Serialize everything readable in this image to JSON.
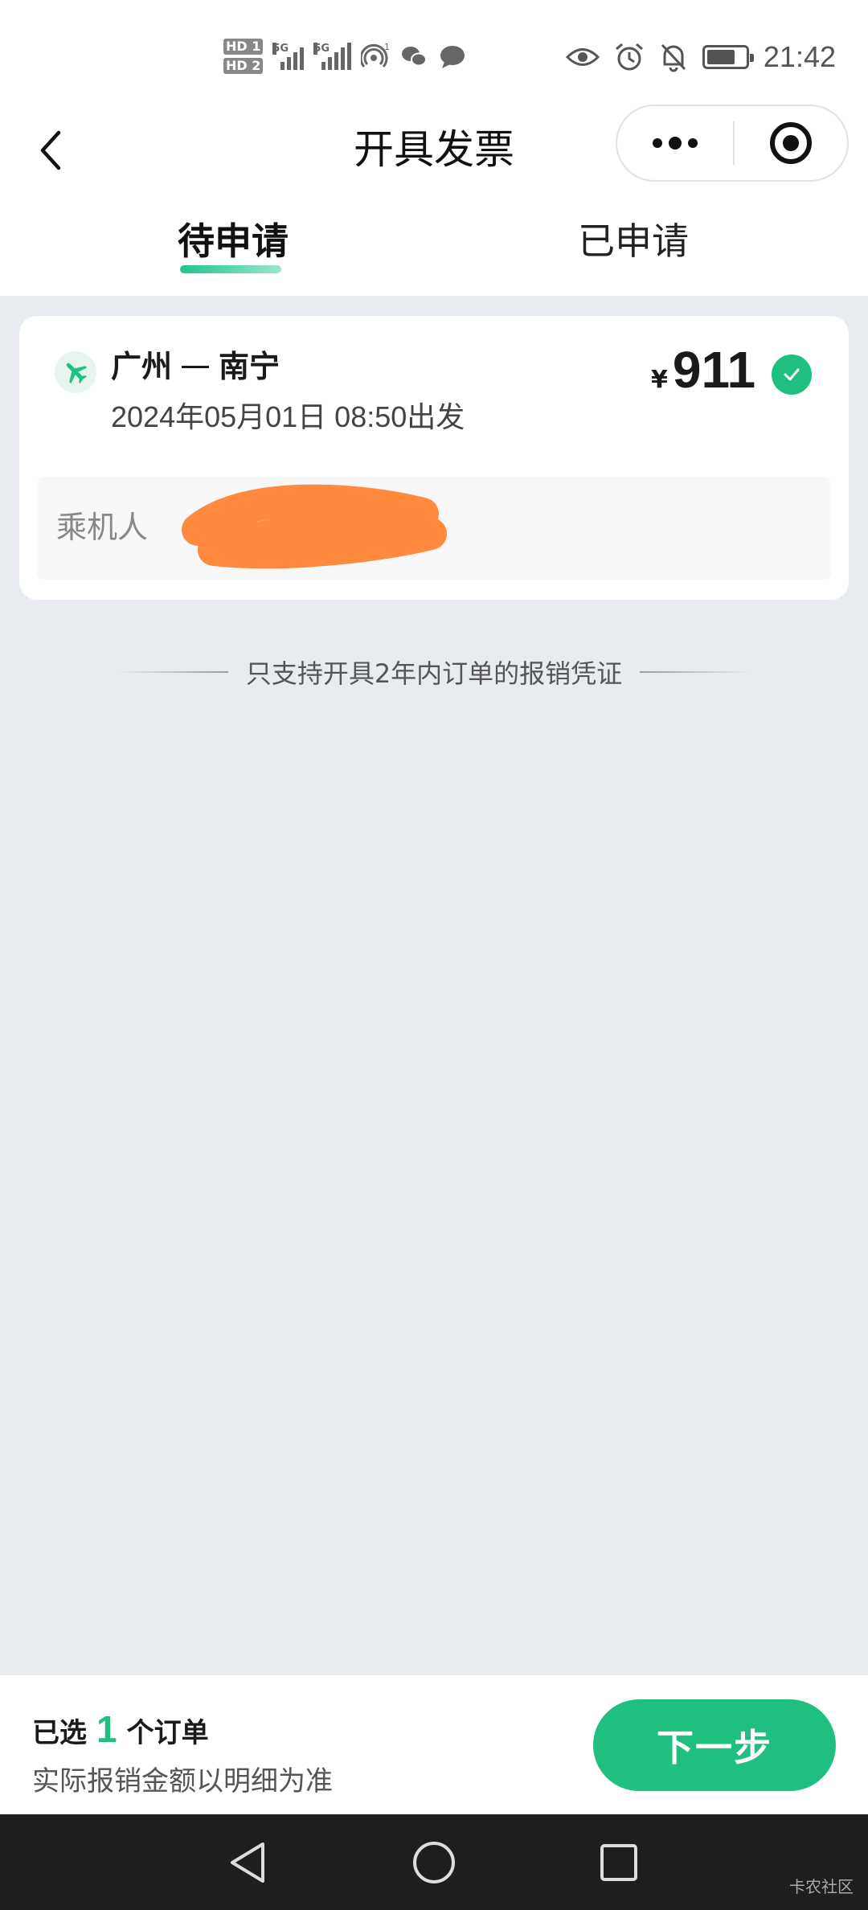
{
  "status_bar": {
    "sim1_label": "HD 1",
    "sim2_label": "HD 2",
    "net1": "5G",
    "net2": "5G",
    "hotspot_count": "1",
    "time": "21:42"
  },
  "nav": {
    "title": "开具发票"
  },
  "tabs": [
    {
      "label": "待申请",
      "active": true
    },
    {
      "label": "已申请",
      "active": false
    }
  ],
  "order": {
    "from": "广州",
    "to": "南宁",
    "departure": "2024年05月01日 08:50出发",
    "currency": "¥",
    "price": "911",
    "selected": true,
    "passenger_label": "乘机人"
  },
  "note": "只支持开具2年内订单的报销凭证",
  "bottom": {
    "selected_prefix": "已选",
    "selected_count": "1",
    "selected_suffix": "个订单",
    "hint": "实际报销金额以明细为准",
    "next_label": "下一步"
  },
  "watermark": "卡农社区",
  "colors": {
    "accent": "#1fbf7f",
    "background": "#e8ebf0"
  }
}
